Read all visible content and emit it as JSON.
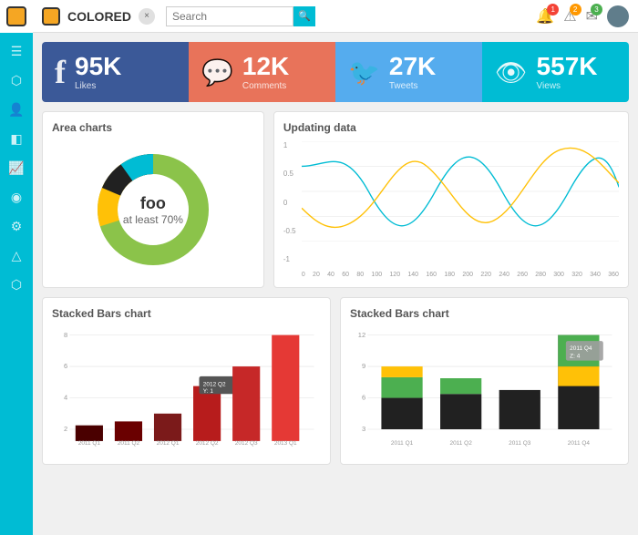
{
  "app": {
    "title": "COLORED",
    "close_label": "×"
  },
  "topbar": {
    "search_placeholder": "Search",
    "search_icon": "🔍",
    "notifications": [
      {
        "badge": "1",
        "color": "red",
        "icon": "🔔"
      },
      {
        "badge": "2",
        "color": "orange",
        "icon": "⚠"
      },
      {
        "badge": "3",
        "color": "green",
        "icon": "📧"
      }
    ]
  },
  "sidebar": {
    "icons": [
      "☰",
      "📊",
      "👤",
      "📁",
      "📈",
      "📌",
      "🔧",
      "△",
      "⬡"
    ]
  },
  "stat_cards": [
    {
      "type": "facebook",
      "icon": "f",
      "number": "95K",
      "label": "Likes"
    },
    {
      "type": "comments",
      "icon": "💬",
      "number": "12K",
      "label": "Comments"
    },
    {
      "type": "twitter",
      "icon": "🐦",
      "number": "27K",
      "label": "Tweets"
    },
    {
      "type": "views",
      "icon": "👁",
      "number": "557K",
      "label": "Views"
    }
  ],
  "area_chart": {
    "title": "Area charts",
    "center_main": "foo",
    "center_sub": "at least 70%",
    "segments": [
      {
        "color": "#8bc34a",
        "pct": 70
      },
      {
        "color": "#ffc107",
        "pct": 12
      },
      {
        "color": "#212121",
        "pct": 10
      },
      {
        "color": "#00bcd4",
        "pct": 8
      }
    ]
  },
  "line_chart": {
    "title": "Updating data",
    "y_labels": [
      "1",
      "0.5",
      "0",
      "-0.5",
      "-1"
    ],
    "x_labels": [
      "0",
      "20",
      "40",
      "60",
      "80",
      "100",
      "120",
      "140",
      "160",
      "180",
      "200",
      "220",
      "240",
      "260",
      "280",
      "300",
      "320",
      "340",
      "360"
    ],
    "series": [
      {
        "color": "#00bcd4"
      },
      {
        "color": "#ffc107"
      }
    ]
  },
  "stacked_bar_left": {
    "title": "Stacked Bars chart",
    "y_labels": [
      "8",
      "6",
      "4",
      "2"
    ],
    "x_labels": [
      "2011 Q1",
      "2011 Q2",
      "2012 Q1",
      "2012 Q2",
      "2012 Q3",
      "2013 Q1"
    ],
    "legend": [
      {
        "label": "2012 Q2",
        "color": "#b71c1c"
      },
      {
        "label": "Y: 1",
        "color": "#d32f2f"
      }
    ]
  },
  "stacked_bar_right": {
    "title": "Stacked Bars chart",
    "y_labels": [
      "12",
      "9",
      "6",
      "3"
    ],
    "x_labels": [
      "2011 Q1",
      "2011 Q2",
      "2011 Q3",
      "2011 Q4"
    ],
    "legend": [
      {
        "label": "2011 Q4",
        "color": "#757575"
      },
      {
        "label": "Z: 4",
        "color": "#9e9e9e"
      }
    ]
  }
}
